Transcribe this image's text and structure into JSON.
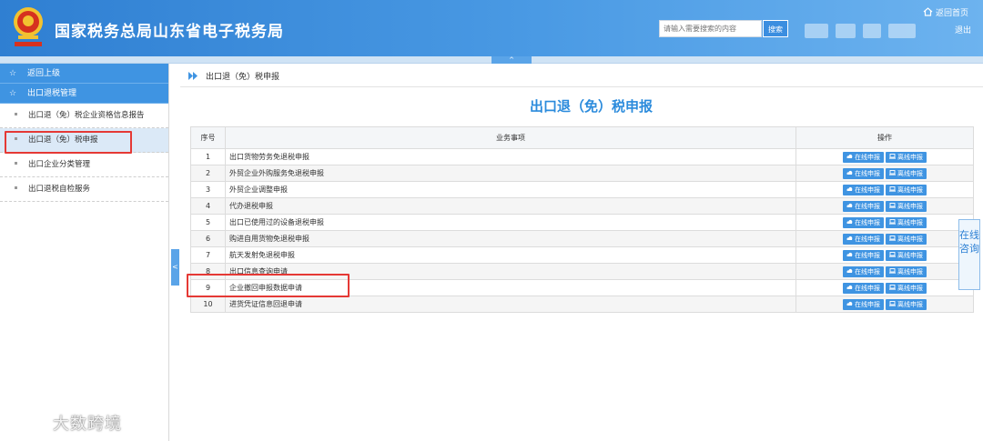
{
  "header": {
    "title": "国家税务总局山东省电子税务局",
    "search_placeholder": "请输入需要搜索的内容",
    "search_button": "搜索",
    "home_link": "返回首页",
    "logout_link": "退出",
    "collapse_glyph": "^",
    "brand_color": "#2f7fd2"
  },
  "sidebar": {
    "back_label": "返回上级",
    "section_label": "出口退税管理",
    "items": [
      {
        "label": "出口退（免）税企业资格信息报告",
        "active": false
      },
      {
        "label": "出口退（免）税申报",
        "active": true
      },
      {
        "label": "出口企业分类管理",
        "active": false
      },
      {
        "label": "出口退税自检服务",
        "active": false
      }
    ],
    "toggle_glyph": "<"
  },
  "breadcrumb": {
    "current": "出口退（免）税申报"
  },
  "page_title": "出口退（免）税申报",
  "table": {
    "headers": [
      "序号",
      "业务事项",
      "操作"
    ],
    "online_label": "在线申报",
    "offline_label": "离线申报",
    "rows": [
      {
        "no": "1",
        "item": "出口货物劳务免退税申报"
      },
      {
        "no": "2",
        "item": "外贸企业外购服务免退税申报"
      },
      {
        "no": "3",
        "item": "外贸企业调整申报"
      },
      {
        "no": "4",
        "item": "代办退税申报"
      },
      {
        "no": "5",
        "item": "出口已使用过的设备退税申报"
      },
      {
        "no": "6",
        "item": "购进自用货物免退税申报"
      },
      {
        "no": "7",
        "item": "航天发射免退税申报"
      },
      {
        "no": "8",
        "item": "出口信息查询申请"
      },
      {
        "no": "9",
        "item": "企业撤回申报数据申请"
      },
      {
        "no": "10",
        "item": "进货凭证信息回退申请"
      }
    ]
  },
  "consult_widget": {
    "label": "在线咨询"
  },
  "watermark": {
    "text": "大数跨境"
  },
  "colors": {
    "accent": "#3f94e2",
    "highlight_box": "#e53935",
    "title_blue": "#2b8bdc"
  }
}
